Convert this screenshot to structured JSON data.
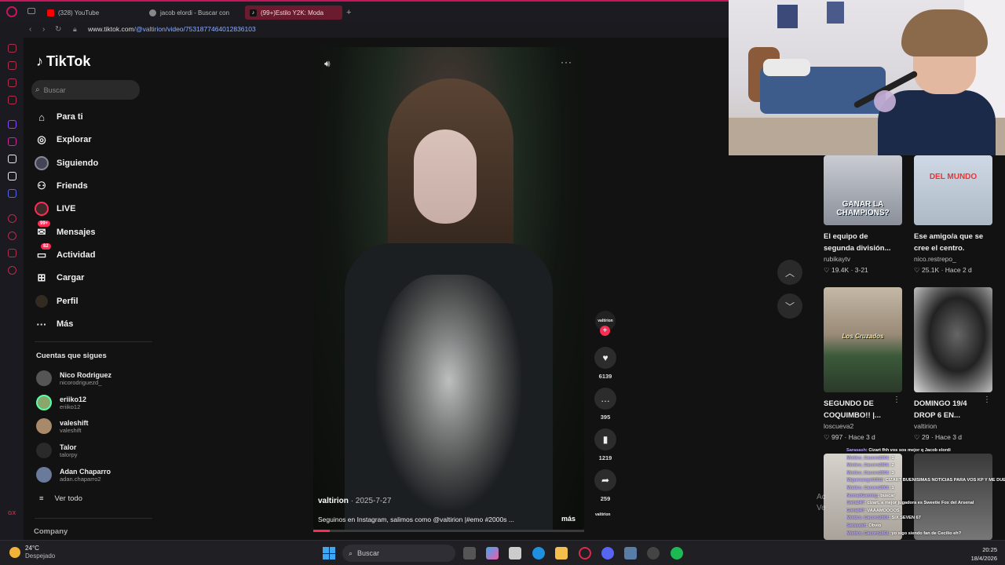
{
  "browser": {
    "tabs": [
      {
        "label": "(328) YouTube",
        "color": "#ff0000"
      },
      {
        "label": "jacob elordi - Buscar con",
        "color": "#888888"
      },
      {
        "label": "(99+)Estilo Y2K: Moda",
        "color": "#fe2c55"
      }
    ],
    "url_host": "www.tiktok.com",
    "url_path": "/@valtirion/video/7531877464012836103"
  },
  "tiktok": {
    "logo": "TikTok",
    "search_placeholder": "Buscar",
    "menu": [
      {
        "label": "Para ti",
        "icon": "home-icon"
      },
      {
        "label": "Explorar",
        "icon": "compass-icon"
      },
      {
        "label": "Siguiendo",
        "icon": "following-icon"
      },
      {
        "label": "Friends",
        "icon": "friends-icon"
      },
      {
        "label": "LIVE",
        "icon": "live-icon"
      },
      {
        "label": "Mensajes",
        "icon": "messages-icon",
        "badge": "99+"
      },
      {
        "label": "Actividad",
        "icon": "activity-icon",
        "badge": "82"
      },
      {
        "label": "Cargar",
        "icon": "upload-icon"
      },
      {
        "label": "Perfil",
        "icon": "profile-icon"
      },
      {
        "label": "Más",
        "icon": "more-icon"
      }
    ],
    "following_title": "Cuentas que sigues",
    "following": [
      {
        "name": "Nico Rodriguez",
        "handle": "nicorodriguezd_"
      },
      {
        "name": "eriiko12",
        "handle": "eriiko12"
      },
      {
        "name": "valeshift",
        "handle": "valeshift"
      },
      {
        "name": "Talor",
        "handle": "talorpy"
      },
      {
        "name": "Adan Chaparro",
        "handle": "adan.chaparro2"
      }
    ],
    "see_all": "Ver todo",
    "company": "Company"
  },
  "video": {
    "author": "valtirion",
    "date": "2025-7-27",
    "caption": "Seguinos en Instagram, salimos como @valtirion |#emo #2000s ...",
    "more": "más",
    "avatar_text": "valtirion",
    "likes": "6139",
    "comments": "395",
    "saves": "1219",
    "shares": "259",
    "progress": 0.06
  },
  "recommendations": [
    {
      "thumb_text": "GANAR LA CHAMPIONS?",
      "title": "El equipo de segunda división...",
      "user": "rubikaytv",
      "likes": "19.4K",
      "date": "3-21"
    },
    {
      "thumb_text": "DEL MUNDO",
      "title": "Ese amigo/a que se cree el centro.",
      "user": "nico.restrepo_",
      "likes": "25.1K",
      "date": "Hace 2 d"
    },
    {
      "thumb_text": "Los Cruzados",
      "title": "SEGUNDO DE COQUIMBO!! |...",
      "user": "loscueva2",
      "likes": "997",
      "date": "Hace 3 d"
    },
    {
      "thumb_text": "",
      "title": "DOMINGO 19/4 DROP 6 EN...",
      "user": "valtirion",
      "likes": "29",
      "date": "Hace 3 d"
    }
  ],
  "chat": [
    {
      "user": "Sarasash",
      "msg": "Cizart fhh vos sos mejor q Jacob elordi"
    },
    {
      "user": "Mistico_Cacoro2801",
      "msg": "1"
    },
    {
      "user": "Mistico_Cacoro2801",
      "msg": "2"
    },
    {
      "user": "Mistico_Cacoro2801",
      "msg": "3"
    },
    {
      "user": "Miguesangel1912",
      "msg": "CIZART BUENISIMAS NOTICIAS PARA VOS KP Y ME DUELE HASTA EL ALMA KPP Y LASTIMOSAMENTE TE ANUNCIO QUE SE ACABO EL MIGUEL ANGEL FAN DE CECILIO"
    },
    {
      "user": "Mistico_Cacoro2801",
      "msg": "1"
    },
    {
      "user": "NomadGaming",
      "msg": "buscar"
    },
    {
      "user": "Giela847",
      "msg": "cizart, a mejor jugadora es Sweetie Fox del Arsenal"
    },
    {
      "user": "Giela847",
      "msg": "VAAAMOOOOS"
    },
    {
      "user": "Mistico_Cacoro2801",
      "msg": "SIX SEVEN 67"
    },
    {
      "user": "Sarasash",
      "msg": "Obvio"
    },
    {
      "user": "Mistico_Cacoro2801",
      "msg": "yo sigo siendo fan de Cecilio eh?"
    }
  ],
  "windows_watermark": [
    "Ac",
    "Ve"
  ],
  "taskbar": {
    "temp": "24°C",
    "weather": "Despejado",
    "search": "Buscar",
    "time": "20:25",
    "date": "18/4/2026"
  }
}
